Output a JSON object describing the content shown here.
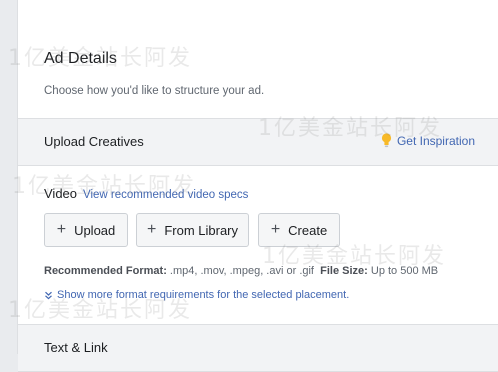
{
  "ad_details": {
    "title": "Ad Details",
    "description": "Choose how you'd like to structure your ad."
  },
  "upload_creatives": {
    "title": "Upload Creatives",
    "inspiration_label": "Get Inspiration"
  },
  "video": {
    "label": "Video",
    "specs_link": "View recommended video specs",
    "buttons": {
      "upload": "Upload",
      "library": "From Library",
      "create": "Create"
    },
    "format_label": "Recommended Format:",
    "format_value": ".mp4, .mov, .mpeg, .avi or .gif",
    "size_label": "File Size:",
    "size_value": "Up to 500 MB",
    "more_link": "Show more format requirements for the selected placement."
  },
  "text_link": {
    "title": "Text & Link"
  },
  "watermarks": [
    "1亿美金站长阿发",
    "1亿美金站长阿发",
    "1亿美金站长阿发",
    "1亿美金站长阿发",
    "1亿美金站长阿发"
  ],
  "colors": {
    "link": "#4267b2",
    "bulb": "#f7b928",
    "band": "#f2f3f5"
  }
}
